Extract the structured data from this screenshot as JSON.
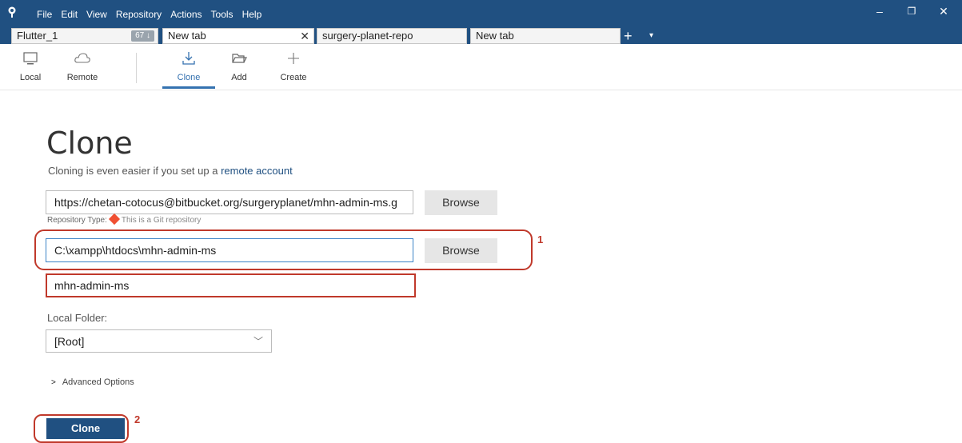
{
  "menu": {
    "items": [
      "File",
      "Edit",
      "View",
      "Repository",
      "Actions",
      "Tools",
      "Help"
    ]
  },
  "window_controls": {
    "minimize": "–",
    "restore": "❐",
    "close": "✕"
  },
  "tabs": [
    {
      "label": "Flutter_1",
      "count": "67 ↓"
    },
    {
      "label": "New tab",
      "close": "✕"
    },
    {
      "label": "surgery-planet-repo"
    },
    {
      "label": "New tab"
    }
  ],
  "tab_add": "+",
  "tab_more": "▾",
  "toolbar": {
    "local": "Local",
    "remote": "Remote",
    "clone": "Clone",
    "add": "Add",
    "create": "Create"
  },
  "page": {
    "title": "Clone",
    "subtitle_prefix": "Cloning is even easier if you set up a ",
    "subtitle_link": "remote account"
  },
  "form": {
    "source_url": "https://chetan-cotocus@bitbucket.org/surgeryplanet/mhn-admin-ms.g",
    "browse_label": "Browse",
    "repo_type_label": "Repository Type:",
    "repo_type_value": "This is a Git repository",
    "destination_path": "C:\\xampp\\htdocs\\mhn-admin-ms",
    "name": "mhn-admin-ms",
    "local_folder_label": "Local Folder:",
    "local_folder_value": "[Root]",
    "advanced_label": "Advanced Options",
    "clone_button": "Clone"
  },
  "annotations": {
    "first": "1",
    "second": "2"
  },
  "colors": {
    "accent": "#205081",
    "annotation": "#c0392b",
    "link": "#3572b0"
  }
}
